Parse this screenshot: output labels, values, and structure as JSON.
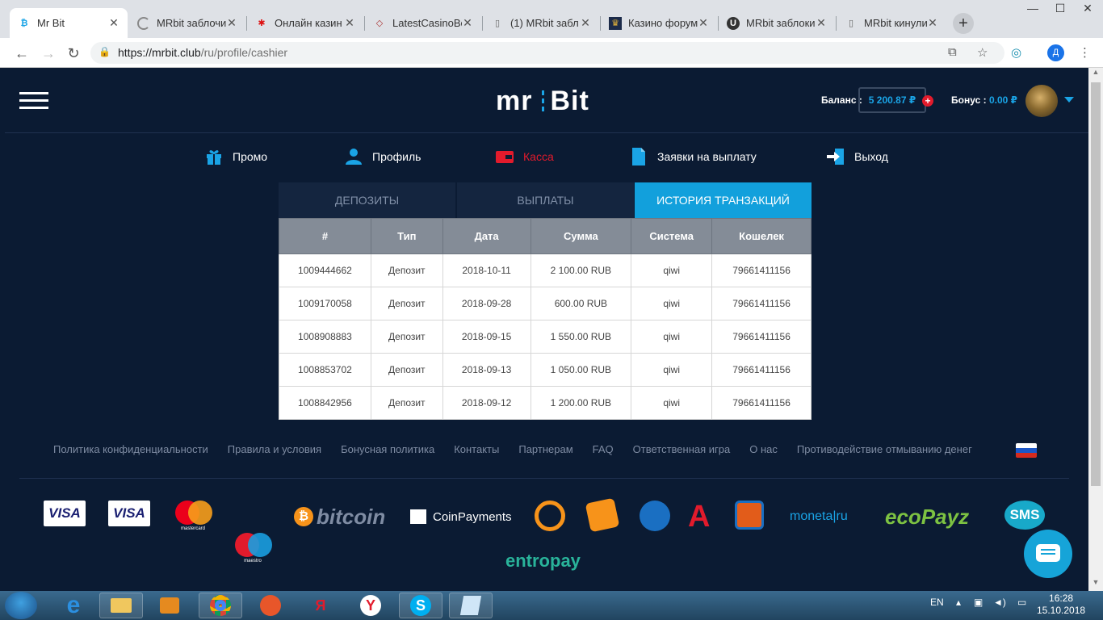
{
  "browser": {
    "tabs": [
      {
        "title": "Mr Bit",
        "active": true
      },
      {
        "title": "MRbit заблочи"
      },
      {
        "title": "Онлайн казин"
      },
      {
        "title": "LatestCasinoBo"
      },
      {
        "title": "(1) MRbit забл"
      },
      {
        "title": "Казино форум"
      },
      {
        "title": "MRbit заблоки"
      },
      {
        "title": "MRbit кинули"
      }
    ],
    "url_host": "https://mrbit.club",
    "url_path": "/ru/profile/cashier",
    "profile_initial": "Д"
  },
  "header": {
    "logo_text_1": "mr",
    "logo_text_2": "Bit",
    "balance_label": "Баланс :",
    "balance_value": "5 200.87 ₽",
    "bonus_label": "Бонус :",
    "bonus_value": "0.00 ₽"
  },
  "nav": {
    "promo": "Промо",
    "profile": "Профиль",
    "cashier": "Касса",
    "withdrawals": "Заявки на выплату",
    "logout": "Выход"
  },
  "cashier_tabs": [
    "Депозиты",
    "Выплаты",
    "История транзакций"
  ],
  "table": {
    "headers": [
      "#",
      "Тип",
      "Дата",
      "Сумма",
      "Система",
      "Кошелек"
    ],
    "rows": [
      [
        "1009444662",
        "Депозит",
        "2018-10-11",
        "2 100.00 RUB",
        "qiwi",
        "79661411156"
      ],
      [
        "1009170058",
        "Депозит",
        "2018-09-28",
        "600.00 RUB",
        "qiwi",
        "79661411156"
      ],
      [
        "1008908883",
        "Депозит",
        "2018-09-15",
        "1 550.00 RUB",
        "qiwi",
        "79661411156"
      ],
      [
        "1008853702",
        "Депозит",
        "2018-09-13",
        "1 050.00 RUB",
        "qiwi",
        "79661411156"
      ],
      [
        "1008842956",
        "Депозит",
        "2018-09-12",
        "1 200.00 RUB",
        "qiwi",
        "79661411156"
      ]
    ]
  },
  "footer": {
    "links": [
      "Политика конфиденциальности",
      "Правила и условия",
      "Бонусная политика",
      "Контакты",
      "Партнерам",
      "FAQ",
      "Ответственная игра",
      "О нас",
      "Противодействие отмыванию денег"
    ],
    "payments": {
      "visa": "VISA",
      "visa_electron": "VISA",
      "mastercard": "mastercard",
      "maestro": "maestro",
      "bitcoin": "bitcoin",
      "coinpayments": "CoinPayments",
      "moneta": "moneta|ru",
      "ecopayz": "ecoPayz",
      "sms": "SMS",
      "entropay": "entropay"
    }
  },
  "taskbar": {
    "lang": "EN",
    "time": "16:28",
    "date": "15.10.2018"
  }
}
